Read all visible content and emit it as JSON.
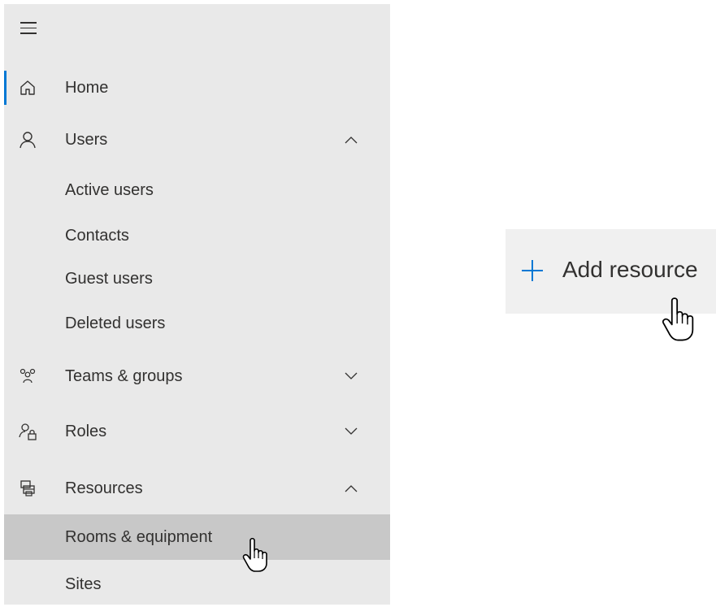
{
  "nav": {
    "home": "Home",
    "users": "Users",
    "users_sub": [
      "Active users",
      "Contacts",
      "Guest users",
      "Deleted users"
    ],
    "teams": "Teams & groups",
    "roles": "Roles",
    "resources": "Resources",
    "resources_sub": [
      "Rooms & equipment",
      "Sites"
    ]
  },
  "toolbar": {
    "add_resource": "Add resource"
  },
  "colors": {
    "accent": "#0078d4",
    "sidebar_bg": "#e9e9e9",
    "selected_bg": "#c8c8c8"
  },
  "icons": {
    "menu": "hamburger-icon",
    "home": "home-icon",
    "users": "person-icon",
    "teams": "people-group-icon",
    "roles": "person-lock-icon",
    "resources": "printer-icon",
    "add": "plus-icon"
  }
}
